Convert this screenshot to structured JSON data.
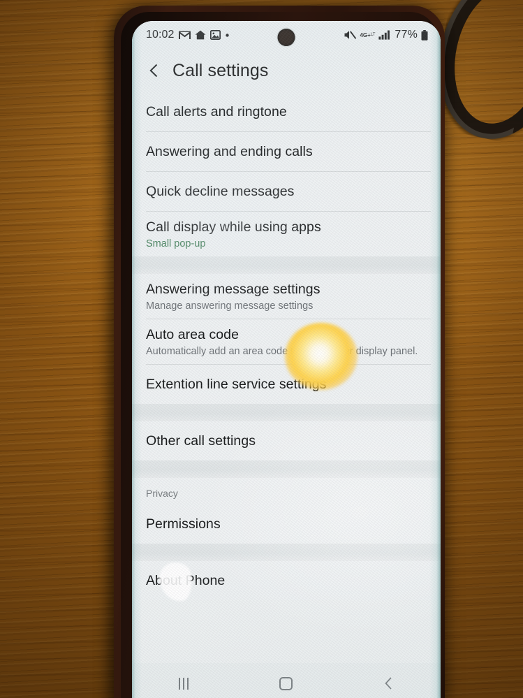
{
  "statusbar": {
    "time": "10:02",
    "left_icons": [
      "gmail-icon",
      "home-app-icon",
      "photos-icon",
      "dot-indicator"
    ],
    "network_label": "4G+",
    "network_sub": "LT",
    "battery_text": "77%",
    "right_icons": [
      "mute-icon",
      "network-4gplus-icon",
      "signal-bars-icon",
      "battery-icon"
    ]
  },
  "appbar": {
    "back_icon": "back-chevron-icon",
    "title": "Call settings"
  },
  "sections": [
    {
      "header": null,
      "items": [
        {
          "title": "Call alerts and ringtone",
          "subtitle": null,
          "accent": false
        },
        {
          "title": "Answering and ending calls",
          "subtitle": null,
          "accent": false
        },
        {
          "title": "Quick decline messages",
          "subtitle": null,
          "accent": false
        },
        {
          "title": "Call display while using apps",
          "subtitle": "Small pop-up",
          "accent": true
        }
      ]
    },
    {
      "header": null,
      "items": [
        {
          "title": "Answering message settings",
          "subtitle": "Manage answering message settings",
          "accent": false
        },
        {
          "title": "Auto area code",
          "subtitle": "Automatically add an area code to the number display panel.",
          "accent": false
        },
        {
          "title": "Extention line service settings",
          "subtitle": null,
          "accent": false
        }
      ]
    },
    {
      "header": null,
      "items": [
        {
          "title": "Other call settings",
          "subtitle": null,
          "accent": false
        }
      ]
    },
    {
      "header": "Privacy",
      "items": [
        {
          "title": "Permissions",
          "subtitle": null,
          "accent": false
        }
      ]
    },
    {
      "header": null,
      "items": [
        {
          "title": "About Phone",
          "subtitle": null,
          "accent": false
        }
      ]
    }
  ],
  "navbar": {
    "recents_label": "recents-icon",
    "home_label": "home-icon",
    "back_label": "back-icon"
  },
  "colors": {
    "accent_green": "#3d7c54",
    "screen_bg": "#eef1f2",
    "section_gap": "#e2e6e7",
    "text_primary": "#17191a",
    "text_secondary": "#6d7276"
  }
}
